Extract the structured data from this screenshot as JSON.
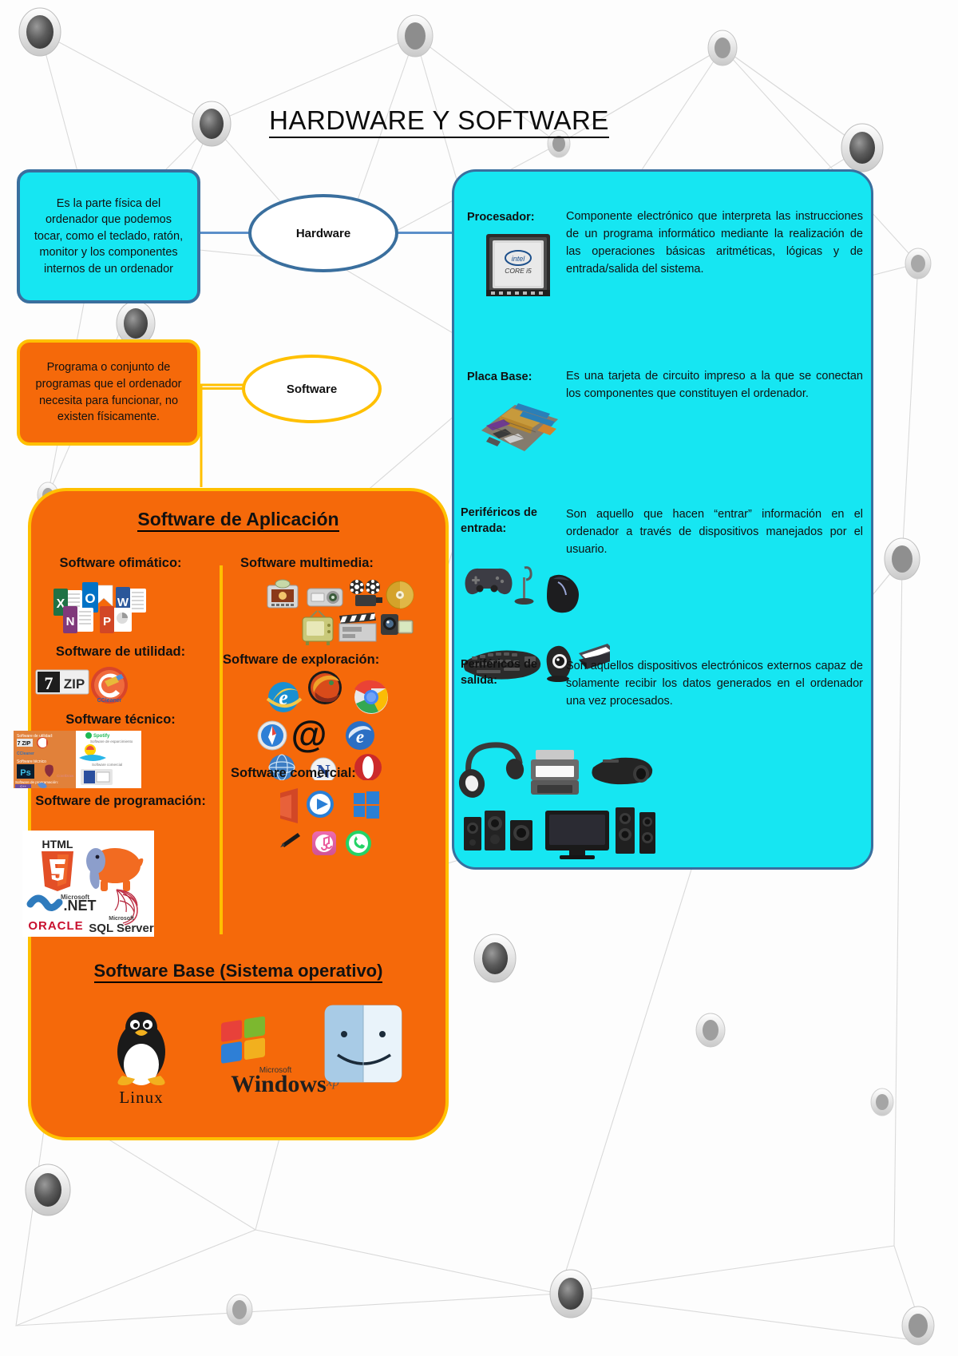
{
  "title": "HARDWARE Y SOFTWARE",
  "nodes": {
    "hardware_label": "Hardware",
    "software_label": "Software"
  },
  "definitions": {
    "hardware": "Es la parte física del ordenador que podemos tocar, como el teclado, ratón, monitor y los componentes internos de un ordenador",
    "software": "Programa o conjunto de programas que el ordenador necesita para funcionar, no existen físicamente."
  },
  "hardware_panel": {
    "items": [
      {
        "label": "Procesador:",
        "text": "Componente electrónico que interpreta las instrucciones de un programa informático mediante la realización de las operaciones básicas aritméticas, lógicas y de entrada/salida del sistema.",
        "image": "intel-core-i5-processor-photo"
      },
      {
        "label": "Placa Base:",
        "text": "Es una tarjeta de circuito impreso a la que se conectan los componentes que constituyen el ordenador.",
        "image": "motherboard-photo"
      },
      {
        "label": "Periféricos de entrada:",
        "text": "Son aquello que hacen “entrar” información en el ordenador a través de dispositivos manejados por el usuario.",
        "image": "input-devices-photo",
        "devices": [
          "gamepad-icon",
          "microphone-icon",
          "mouse-icon",
          "keyboard-icon",
          "webcam-icon",
          "scanner-icon"
        ]
      },
      {
        "label": "Periféricos de salida:",
        "text": "Son aquellos dispositivos electrónicos externos capaz de solamente recibir los datos generados en el ordenador una vez procesados.",
        "image": "output-devices-photo",
        "devices": [
          "headphones-icon",
          "printer-icon",
          "projector-icon",
          "speaker-icon",
          "subwoofer-icon",
          "monitor-icon",
          "tower-speaker-icon"
        ]
      }
    ]
  },
  "software_panel": {
    "title": "Software de Aplicación",
    "base_title": "Software Base (Sistema operativo)",
    "categories": [
      {
        "heading": "Software ofimático:",
        "icons": [
          "excel-icon",
          "outlook-icon",
          "word-icon",
          "onenote-icon",
          "powerpoint-icon"
        ]
      },
      {
        "heading": "Software de utilidad:",
        "icons": [
          "7zip-icon",
          "ccleaner-icon"
        ]
      },
      {
        "heading": "Software técnico:",
        "icons": [
          "technical-software-collage"
        ]
      },
      {
        "heading": "Software de programación:",
        "icons": [
          "html5-icon",
          "php-elephant-icon",
          "dotnet-icon",
          "sqlserver-icon",
          "oracle-icon"
        ]
      },
      {
        "heading": "Software multimedia:",
        "icons": [
          "slide-projector-icon",
          "projector-icon",
          "film-camera-icon",
          "cd-disc-icon",
          "television-icon",
          "clapperboard-icon",
          "camcorder-icon"
        ]
      },
      {
        "heading": "Software de exploración:",
        "icons": [
          "internet-explorer-icon",
          "firefox-icon",
          "chrome-icon",
          "safari-icon",
          "at-sign-icon",
          "ie-blue-icon",
          "opera-globe-icon",
          "netscape-icon",
          "opera-red-icon"
        ]
      },
      {
        "heading": "Software comercial:",
        "icons": [
          "office-icon",
          "media-player-icon",
          "windows-store-icon",
          "pen-icon",
          "itunes-icon",
          "whatsapp-icon"
        ]
      }
    ],
    "operating_systems": [
      "linux-penguin-icon",
      "windows-xp-icon",
      "mac-finder-icon"
    ]
  },
  "os_labels": {
    "linux": "Linux",
    "windows_brand": "Microsoft",
    "windows": "Windows",
    "windows_edition": "xp"
  },
  "brand_text": {
    "intel": "intel",
    "core_i5": "CORE i5",
    "sevenzip_7": "7",
    "sevenzip_zip": "ZIP",
    "html": "HTML",
    "html_5": "5",
    "dotnet_ms": "Microsoft",
    "dotnet": ".NET",
    "oracle": "ORACLE",
    "sqlserver_ms": "Microsoft",
    "sqlserver": "SQL Server",
    "ccleaner": "CCleaner",
    "excel": "X",
    "outlook": "O",
    "word": "W",
    "onenote": "N",
    "powerpoint": "P",
    "at": "@"
  },
  "colors": {
    "cyan": "#16E6F2",
    "orange": "#F5690A",
    "yellow_border": "#FFC000",
    "blue_border": "#3A6F9E",
    "white": "#FFFFFF",
    "text": "#111111"
  }
}
